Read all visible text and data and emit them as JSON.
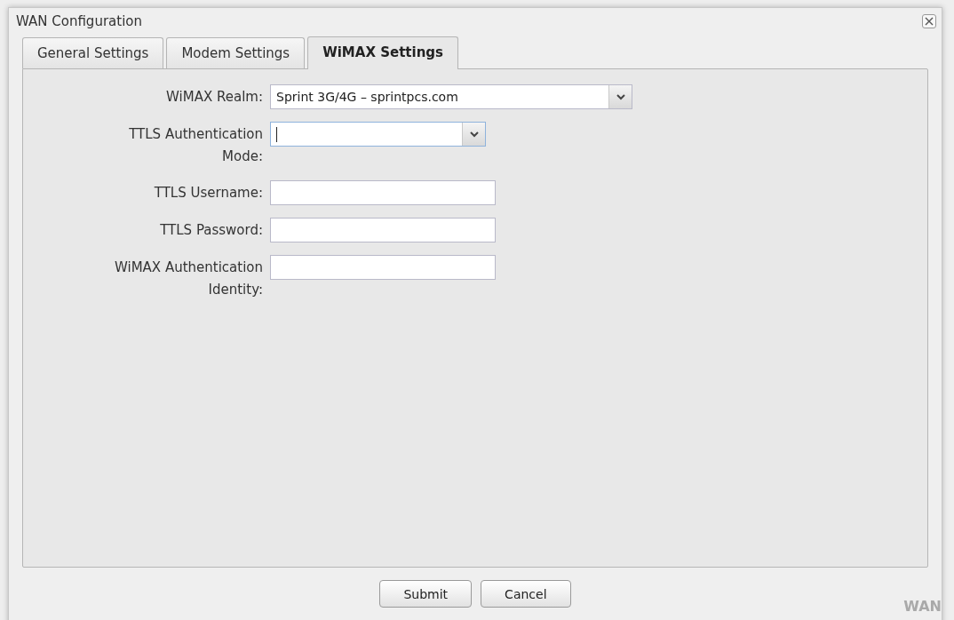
{
  "background_page": {
    "text": "WAN"
  },
  "dialog": {
    "title": "WAN Configuration"
  },
  "tabs": [
    {
      "label": "General Settings",
      "selected": false
    },
    {
      "label": "Modem Settings",
      "selected": false
    },
    {
      "label": "WiMAX Settings",
      "selected": true
    }
  ],
  "fields": [
    {
      "kind": "wideselect",
      "label": "WiMAX Realm:",
      "value": "Sprint 3G/4G – sprintpcs.com",
      "focused": false
    },
    {
      "kind": "select",
      "label": "TTLS Authentication Mode:",
      "focused": true
    },
    {
      "kind": "text",
      "label": "TTLS Username:",
      "focused": false
    },
    {
      "kind": "text",
      "label": "TTLS Password:",
      "focused": false
    },
    {
      "kind": "text",
      "label": "WiMAX Authentication Identity:",
      "focused": false
    }
  ],
  "buttons": [
    "Submit",
    "Cancel"
  ]
}
